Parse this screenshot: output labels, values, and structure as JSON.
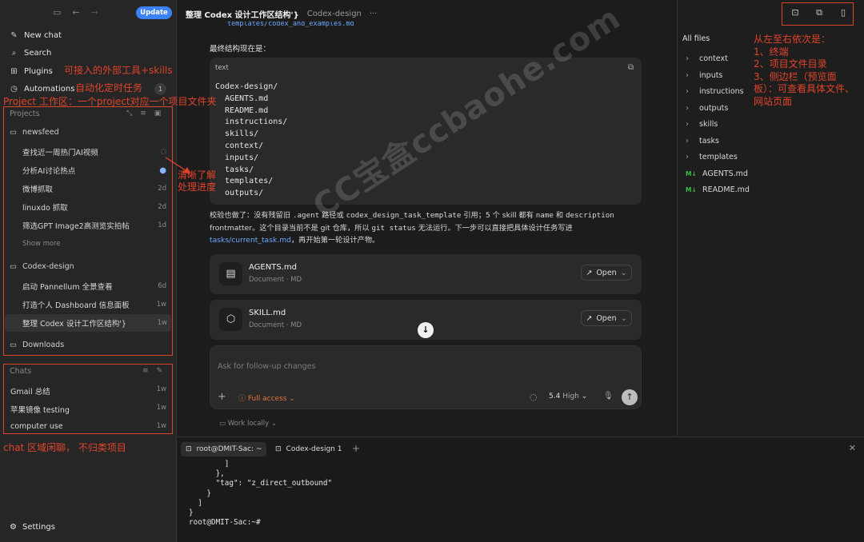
{
  "sidebar": {
    "update_label": "Update",
    "nav": [
      {
        "label": "New chat",
        "icon": "new-chat-icon"
      },
      {
        "label": "Search",
        "icon": "search-icon"
      },
      {
        "label": "Plugins",
        "icon": "plugins-icon"
      },
      {
        "label": "Automations",
        "icon": "clock-icon",
        "badge": "1"
      }
    ],
    "projects_label": "Projects",
    "projects": [
      {
        "name": "newsfeed",
        "threads": [
          {
            "title": "查找近一周热门AI视频",
            "meta": "spinner"
          },
          {
            "title": "分析AI讨论热点",
            "meta": "unread-dot"
          },
          {
            "title": "微博抓取",
            "meta": "2d"
          },
          {
            "title": "linuxdo 抓取",
            "meta": "2d"
          },
          {
            "title": "筛选GPT Image2高测览实拍帖",
            "meta": "1d"
          }
        ],
        "show_more": "Show more"
      },
      {
        "name": "Codex-design",
        "threads": [
          {
            "title": "启动 Pannellum 全景查看",
            "meta": "6d"
          },
          {
            "title": "打造个人 Dashboard 信息面板",
            "meta": "1w"
          },
          {
            "title": "整理 Codex 设计工作区结构'}",
            "meta": "1w"
          }
        ]
      },
      {
        "name": "Downloads",
        "threads": []
      }
    ],
    "chats_label": "Chats",
    "chats": [
      {
        "title": "Gmail 总结",
        "meta": "1w"
      },
      {
        "title": "苹果镜像 testing",
        "meta": "1w"
      },
      {
        "title": "computer use",
        "meta": "1w"
      }
    ],
    "settings_label": "Settings"
  },
  "annotations": {
    "plugins": "可接入的外部工具+skills",
    "automations": "自动化定时任务",
    "projects": "Project 工作区：一个project对应一个项目文件夹",
    "progress": "清晰了解\n处理进度",
    "chats": "chat 区域闲聊， 不归类项目",
    "panels": "从左至右依次是：\n1、终端\n2、项目文件目录\n3、侧边栏（预览面\n板）：可查看具体文件、\n网站页面"
  },
  "header": {
    "title": "整理 Codex 设计工作区结构'}",
    "project": "Codex-design",
    "more": "···"
  },
  "message": {
    "cut_line": "templates/codex_and_examples.md",
    "intro": "最终结构现在是：",
    "code_lang": "text",
    "code": "Codex-design/\n  AGENTS.md\n  README.md\n  instructions/\n  skills/\n  context/\n  inputs/\n  tasks/\n  templates/\n  outputs/",
    "para_1": "校验也做了：没有残留旧 ",
    "code_agent": ".agent",
    "para_2": " 路径或 ",
    "code_tmpl": "codex_design_task_template",
    "para_3": " 引用；5 个 skill 都有 ",
    "code_name": "name",
    "para_4": " 和 ",
    "code_desc": "description",
    "para_5": "frontmatter。这个目录当前不是 git 仓库，所以 ",
    "code_git": "git status",
    "para_6": " 无法运行。下一步可以直接把具体设计任务写进",
    "link": "tasks/current_task.md",
    "para_7": "，再开始第一轮设计产物。"
  },
  "cards": [
    {
      "name": "AGENTS.md",
      "sub": "Document · MD",
      "open": "Open",
      "icon": "document-icon"
    },
    {
      "name": "SKILL.md",
      "sub": "Document · MD",
      "open": "Open",
      "icon": "cube-icon"
    }
  ],
  "composer": {
    "placeholder": "Ask for follow-up changes",
    "access": "Full access",
    "model": "5.4",
    "level": "High",
    "work_locally": "Work locally"
  },
  "files": {
    "header": "All files",
    "items": [
      {
        "name": "context",
        "type": "folder"
      },
      {
        "name": "inputs",
        "type": "folder"
      },
      {
        "name": "instructions",
        "type": "folder"
      },
      {
        "name": "outputs",
        "type": "folder"
      },
      {
        "name": "skills",
        "type": "folder"
      },
      {
        "name": "tasks",
        "type": "folder"
      },
      {
        "name": "templates",
        "type": "folder"
      },
      {
        "name": "AGENTS.md",
        "type": "md"
      },
      {
        "name": "README.md",
        "type": "md"
      }
    ]
  },
  "terminal": {
    "tabs": [
      "root@DMIT-Sac: ~",
      "Codex-design 1"
    ],
    "output": "        ]\n      },\n      \"tag\": \"z_direct_outbound\"\n    }\n  ]\n}\nroot@DMIT-Sac:~#"
  },
  "watermark": "CC宝盒ccbaohe.com",
  "colors": {
    "accent": "#3b82f6",
    "annotation": "#e0442a",
    "access": "#e0763c",
    "md_icon": "#3fb950"
  }
}
